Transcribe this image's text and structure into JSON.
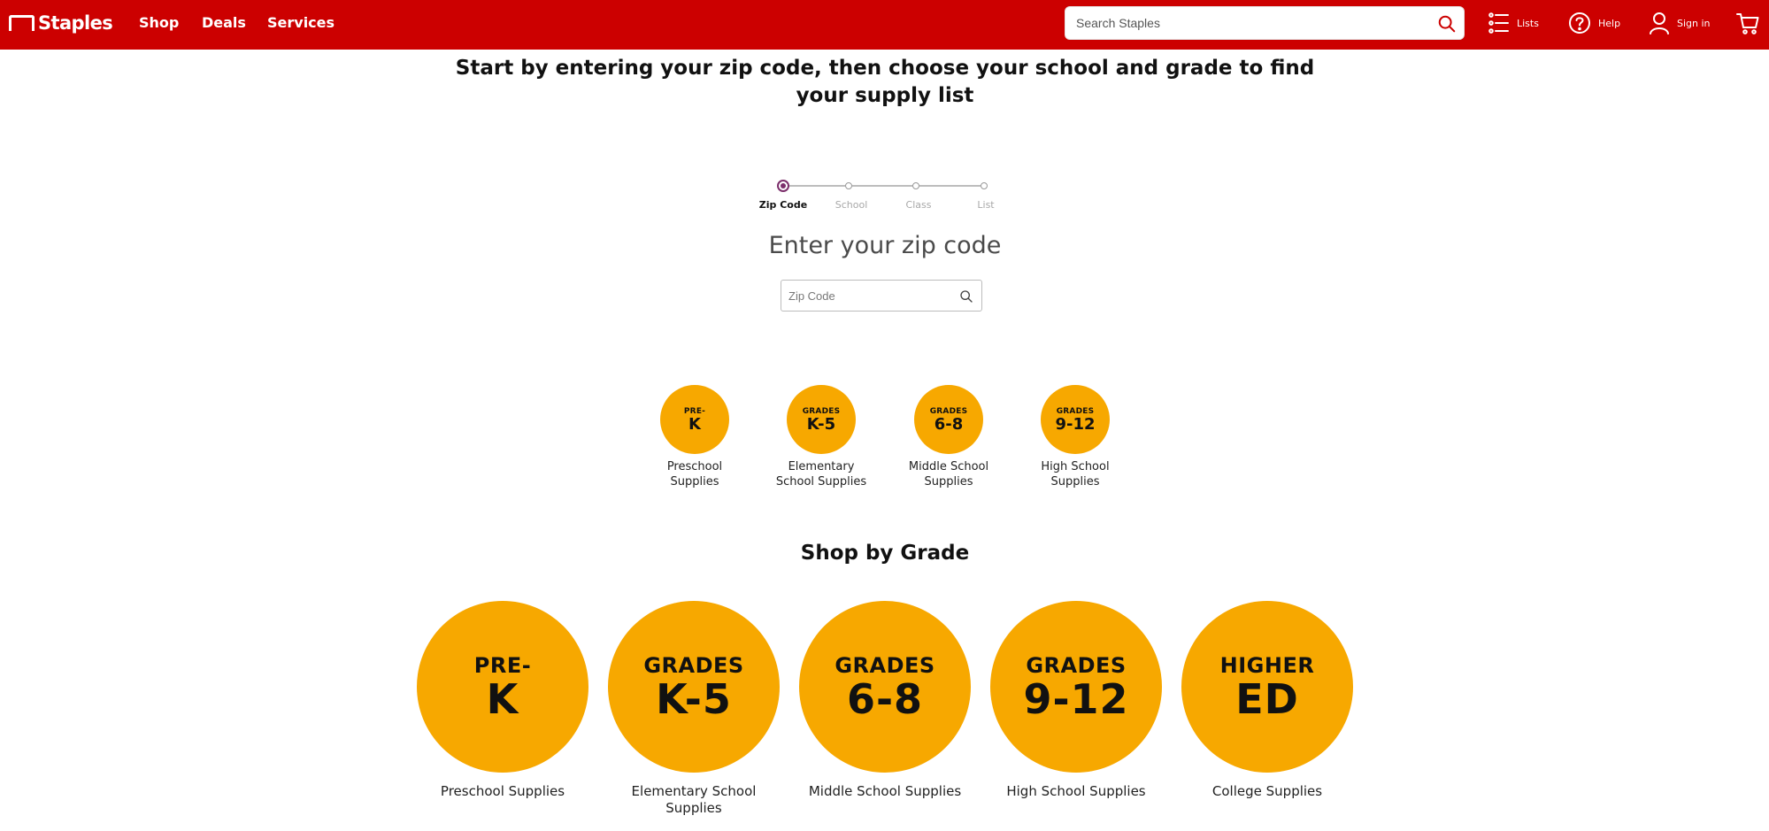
{
  "header": {
    "logo_text": "Staples",
    "nav": [
      "Shop",
      "Deals",
      "Services"
    ],
    "search": {
      "placeholder": "Search Staples"
    },
    "lists_label": "Lists",
    "help_label": "Help",
    "signin_label": "Sign in",
    "brand_color": "#cc0000",
    "icons": [
      "search-icon",
      "lists-icon",
      "help-icon",
      "user-icon",
      "cart-icon"
    ]
  },
  "main": {
    "heading": "Start by entering your zip code, then choose your school and grade to find your supply list",
    "stepper": {
      "steps": [
        "Zip Code",
        "School",
        "Class",
        "List"
      ],
      "active": "Zip Code"
    },
    "zip_heading": "Enter your zip code",
    "zip_input": {
      "placeholder": "Zip Code",
      "value": ""
    }
  },
  "small_grades": [
    {
      "top": "PRE-",
      "big": "K",
      "label_line1": "Preschool",
      "label_line2": "Supplies"
    },
    {
      "top": "GRADES",
      "big": "K-5",
      "label_line1": "Elementary",
      "label_line2": "School Supplies"
    },
    {
      "top": "GRADES",
      "big": "6-8",
      "label_line1": "Middle School",
      "label_line2": "Supplies"
    },
    {
      "top": "GRADES",
      "big": "9-12",
      "label_line1": "High School",
      "label_line2": "Supplies"
    }
  ],
  "shop_by_grade": {
    "heading": "Shop by Grade",
    "items": [
      {
        "top": "PRE-",
        "big": "K",
        "label_line1": "Preschool Supplies",
        "label_line2": ""
      },
      {
        "top": "GRADES",
        "big": "K-5",
        "label_line1": "Elementary School",
        "label_line2": "Supplies"
      },
      {
        "top": "GRADES",
        "big": "6-8",
        "label_line1": "Middle School Supplies",
        "label_line2": ""
      },
      {
        "top": "GRADES",
        "big": "9-12",
        "label_line1": "High School Supplies",
        "label_line2": ""
      },
      {
        "top": "HIGHER",
        "big": "ED",
        "label_line1": "College Supplies",
        "label_line2": ""
      }
    ],
    "circle_color": "#f7a800"
  }
}
